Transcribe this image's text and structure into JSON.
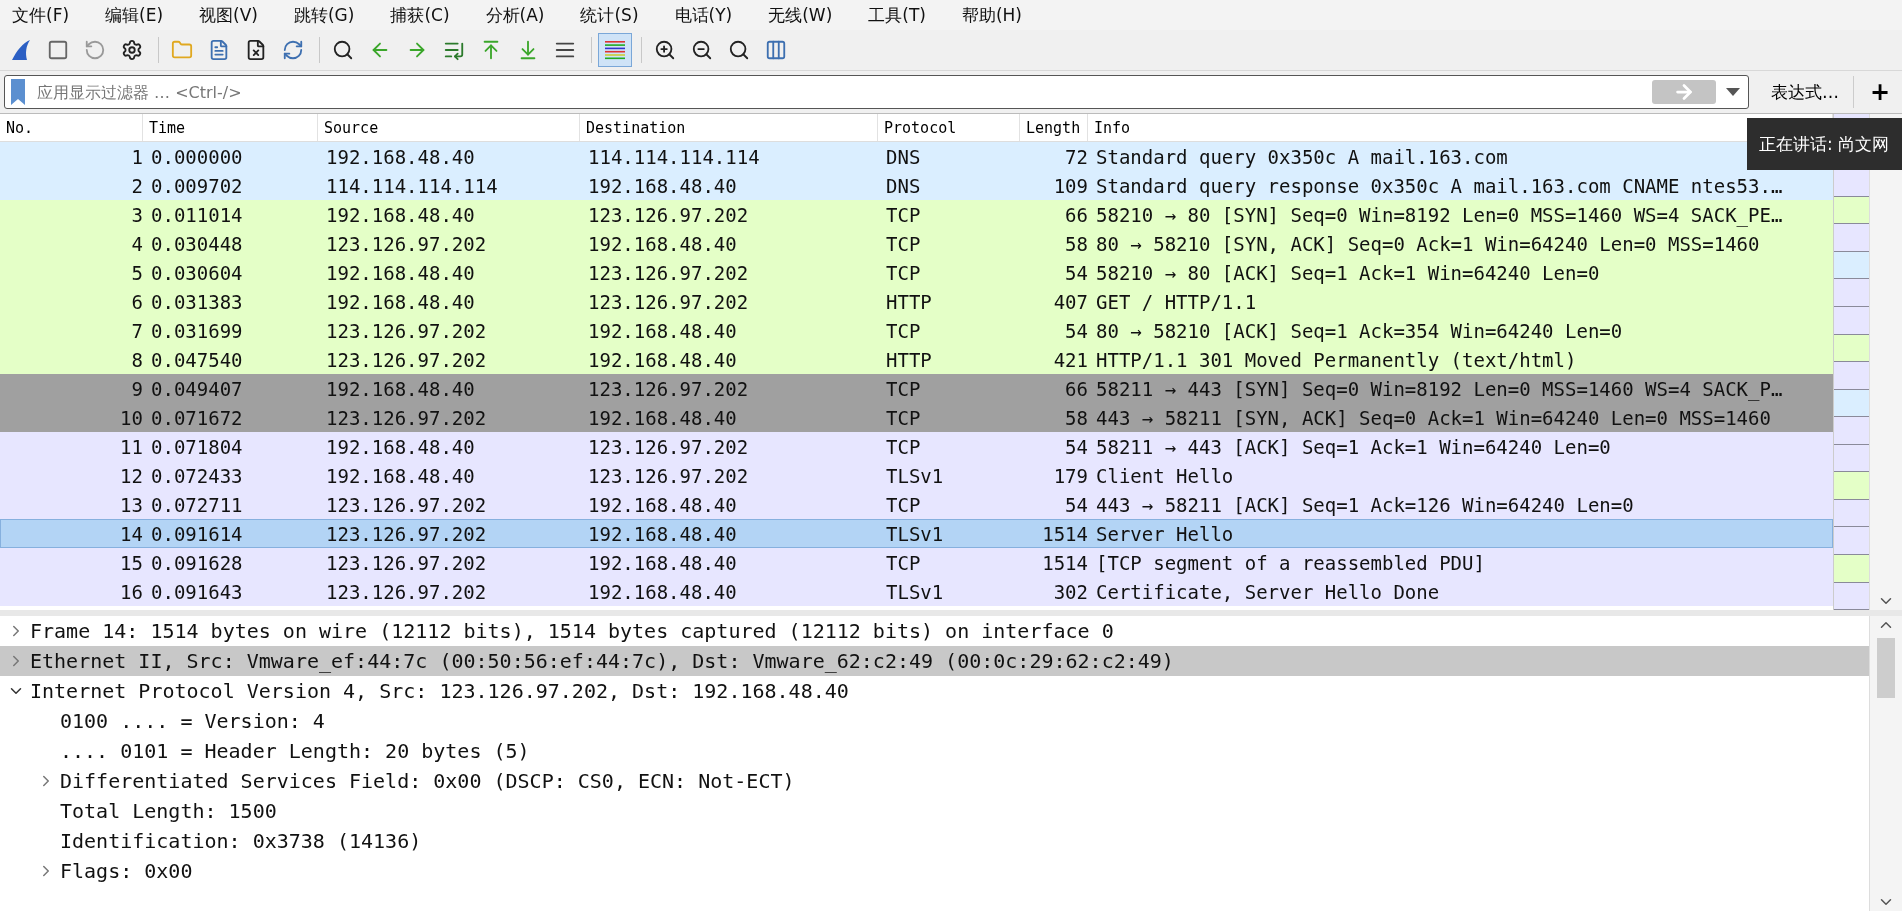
{
  "menu": [
    {
      "label": "文件(F)"
    },
    {
      "label": "编辑(E)"
    },
    {
      "label": "视图(V)"
    },
    {
      "label": "跳转(G)"
    },
    {
      "label": "捕获(C)"
    },
    {
      "label": "分析(A)"
    },
    {
      "label": "统计(S)"
    },
    {
      "label": "电话(Y)"
    },
    {
      "label": "无线(W)"
    },
    {
      "label": "工具(T)"
    },
    {
      "label": "帮助(H)"
    }
  ],
  "toolbar": [
    {
      "pressed": false
    },
    {
      "pressed": false
    },
    {
      "pressed": false
    },
    {
      "pressed": false
    },
    {
      "pressed": false
    },
    {
      "pressed": false
    },
    {
      "pressed": false
    },
    {
      "pressed": false
    },
    {
      "pressed": false
    },
    {
      "pressed": false
    },
    {
      "pressed": false
    },
    {
      "pressed": false
    },
    {
      "pressed": false
    },
    {
      "pressed": false
    },
    {
      "pressed": false
    },
    {
      "pressed": true
    },
    {
      "pressed": false
    },
    {
      "pressed": false
    },
    {
      "pressed": false
    },
    {
      "pressed": false
    }
  ],
  "filter": {
    "placeholder": "应用显示过滤器 … <Ctrl-/>",
    "expression_button": "表达式…",
    "add_button": "+"
  },
  "overlay": {
    "text": "正在讲话: 尚文网"
  },
  "packet_list": {
    "columns": [
      "No.",
      "Time",
      "Source",
      "Destination",
      "Protocol",
      "Length",
      "Info"
    ],
    "rows": [
      {
        "no": "1",
        "time": "0.000000",
        "source": "192.168.48.40",
        "destination": "114.114.114.114",
        "protocol": "DNS",
        "length": "72",
        "info": "Standard query 0x350c A mail.163.com",
        "color": "#daeeff",
        "selected": false
      },
      {
        "no": "2",
        "time": "0.009702",
        "source": "114.114.114.114",
        "destination": "192.168.48.40",
        "protocol": "DNS",
        "length": "109",
        "info": "Standard query response 0x350c A mail.163.com CNAME ntes53.…",
        "color": "#daeeff",
        "selected": false
      },
      {
        "no": "3",
        "time": "0.011014",
        "source": "192.168.48.40",
        "destination": "123.126.97.202",
        "protocol": "TCP",
        "length": "66",
        "info": "58210 → 80 [SYN] Seq=0 Win=8192 Len=0 MSS=1460 WS=4 SACK_PE…",
        "color": "#e4ffc7",
        "selected": false
      },
      {
        "no": "4",
        "time": "0.030448",
        "source": "123.126.97.202",
        "destination": "192.168.48.40",
        "protocol": "TCP",
        "length": "58",
        "info": "80 → 58210 [SYN, ACK] Seq=0 Ack=1 Win=64240 Len=0 MSS=1460",
        "color": "#e4ffc7",
        "selected": false
      },
      {
        "no": "5",
        "time": "0.030604",
        "source": "192.168.48.40",
        "destination": "123.126.97.202",
        "protocol": "TCP",
        "length": "54",
        "info": "58210 → 80 [ACK] Seq=1 Ack=1 Win=64240 Len=0",
        "color": "#e4ffc7",
        "selected": false
      },
      {
        "no": "6",
        "time": "0.031383",
        "source": "192.168.48.40",
        "destination": "123.126.97.202",
        "protocol": "HTTP",
        "length": "407",
        "info": "GET / HTTP/1.1",
        "color": "#e4ffc7",
        "selected": false
      },
      {
        "no": "7",
        "time": "0.031699",
        "source": "123.126.97.202",
        "destination": "192.168.48.40",
        "protocol": "TCP",
        "length": "54",
        "info": "80 → 58210 [ACK] Seq=1 Ack=354 Win=64240 Len=0",
        "color": "#e4ffc7",
        "selected": false
      },
      {
        "no": "8",
        "time": "0.047540",
        "source": "123.126.97.202",
        "destination": "192.168.48.40",
        "protocol": "HTTP",
        "length": "421",
        "info": "HTTP/1.1 301 Moved Permanently  (text/html)",
        "color": "#e4ffc7",
        "selected": false
      },
      {
        "no": "9",
        "time": "0.049407",
        "source": "192.168.48.40",
        "destination": "123.126.97.202",
        "protocol": "TCP",
        "length": "66",
        "info": "58211 → 443 [SYN] Seq=0 Win=8192 Len=0 MSS=1460 WS=4 SACK_P…",
        "color": "#a0a0a0",
        "selected": false
      },
      {
        "no": "10",
        "time": "0.071672",
        "source": "123.126.97.202",
        "destination": "192.168.48.40",
        "protocol": "TCP",
        "length": "58",
        "info": "443 → 58211 [SYN, ACK] Seq=0 Ack=1 Win=64240 Len=0 MSS=1460",
        "color": "#a0a0a0",
        "selected": false
      },
      {
        "no": "11",
        "time": "0.071804",
        "source": "192.168.48.40",
        "destination": "123.126.97.202",
        "protocol": "TCP",
        "length": "54",
        "info": "58211 → 443 [ACK] Seq=1 Ack=1 Win=64240 Len=0",
        "color": "#e7e6ff",
        "selected": false
      },
      {
        "no": "12",
        "time": "0.072433",
        "source": "192.168.48.40",
        "destination": "123.126.97.202",
        "protocol": "TLSv1",
        "length": "179",
        "info": "Client Hello",
        "color": "#e7e6ff",
        "selected": false
      },
      {
        "no": "13",
        "time": "0.072711",
        "source": "123.126.97.202",
        "destination": "192.168.48.40",
        "protocol": "TCP",
        "length": "54",
        "info": "443 → 58211 [ACK] Seq=1 Ack=126 Win=64240 Len=0",
        "color": "#e7e6ff",
        "selected": false
      },
      {
        "no": "14",
        "time": "0.091614",
        "source": "123.126.97.202",
        "destination": "192.168.48.40",
        "protocol": "TLSv1",
        "length": "1514",
        "info": "Server Hello",
        "color": "#b3d4f5",
        "selected": true
      },
      {
        "no": "15",
        "time": "0.091628",
        "source": "123.126.97.202",
        "destination": "192.168.48.40",
        "protocol": "TCP",
        "length": "1514",
        "info": "[TCP segment of a reassembled PDU]",
        "color": "#e7e6ff",
        "selected": false
      },
      {
        "no": "16",
        "time": "0.091643",
        "source": "123.126.97.202",
        "destination": "192.168.48.40",
        "protocol": "TLSv1",
        "length": "302",
        "info": "Certificate, Server Hello Done",
        "color": "#e7e6ff",
        "selected": false
      }
    ]
  },
  "details": [
    {
      "kind": "branch",
      "text": "Frame 14: 1514 bytes on wire (12112 bits), 1514 bytes captured (12112 bits) on interface 0",
      "expanded": false,
      "selected": false
    },
    {
      "kind": "branch",
      "text": "Ethernet II, Src: Vmware_ef:44:7c (00:50:56:ef:44:7c), Dst: Vmware_62:c2:49 (00:0c:29:62:c2:49)",
      "expanded": false,
      "selected": true
    },
    {
      "kind": "branch",
      "text": "Internet Protocol Version 4, Src: 123.126.97.202, Dst: 192.168.48.40",
      "expanded": true,
      "selected": false,
      "children": [
        {
          "kind": "leaf",
          "text": "0100 .... = Version: 4",
          "selected": false
        },
        {
          "kind": "leaf",
          "text": ".... 0101 = Header Length: 20 bytes (5)",
          "selected": false
        },
        {
          "kind": "branch",
          "text": "Differentiated Services Field: 0x00 (DSCP: CS0, ECN: Not-ECT)",
          "expanded": false,
          "selected": false
        },
        {
          "kind": "leaf",
          "text": "Total Length: 1500",
          "selected": false
        },
        {
          "kind": "leaf",
          "text": "Identification: 0x3738 (14136)",
          "selected": false
        },
        {
          "kind": "branch",
          "text": "Flags: 0x00",
          "expanded": false,
          "selected": false
        }
      ]
    }
  ]
}
